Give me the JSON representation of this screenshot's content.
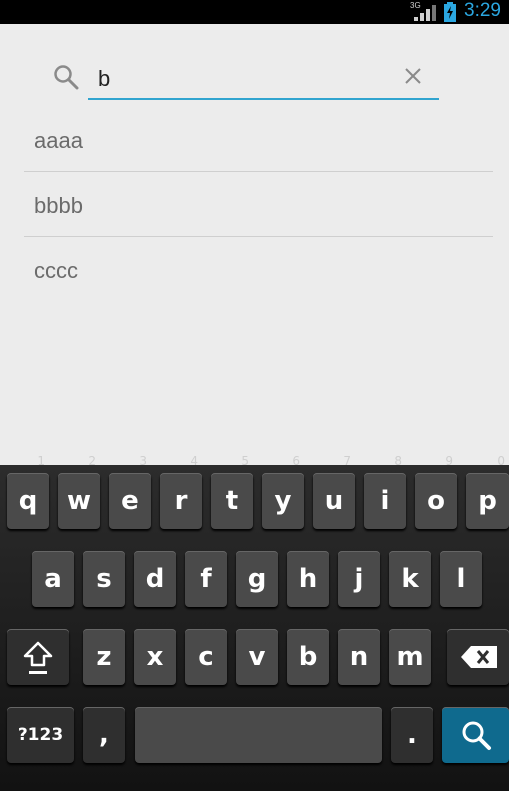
{
  "status_bar": {
    "network": "3G",
    "time": "3:29"
  },
  "search": {
    "value": "b"
  },
  "list": {
    "items": [
      {
        "label": "aaaa"
      },
      {
        "label": "bbbb"
      },
      {
        "label": "cccc"
      }
    ]
  },
  "keyboard": {
    "row1": [
      {
        "key": "q",
        "alt": "1"
      },
      {
        "key": "w",
        "alt": "2"
      },
      {
        "key": "e",
        "alt": "3"
      },
      {
        "key": "r",
        "alt": "4"
      },
      {
        "key": "t",
        "alt": "5"
      },
      {
        "key": "y",
        "alt": "6"
      },
      {
        "key": "u",
        "alt": "7"
      },
      {
        "key": "i",
        "alt": "8"
      },
      {
        "key": "o",
        "alt": "9"
      },
      {
        "key": "p",
        "alt": "0"
      }
    ],
    "row2": [
      "a",
      "s",
      "d",
      "f",
      "g",
      "h",
      "j",
      "k",
      "l"
    ],
    "row3": [
      "z",
      "x",
      "c",
      "v",
      "b",
      "n",
      "m"
    ],
    "symbols_label": "?123",
    "comma_label": ",",
    "period_label": "."
  }
}
